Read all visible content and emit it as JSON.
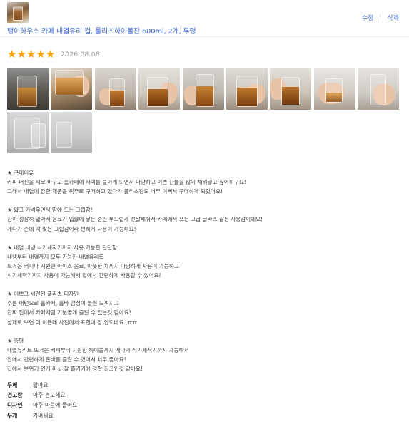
{
  "product": {
    "title": "탱이하우스 카페 내열유리 컵, 플리츠하이볼잔 600ml, 2개, 투명"
  },
  "actions": {
    "edit": "수정",
    "delete": "삭제"
  },
  "review": {
    "rating": 5,
    "rating_max": 5,
    "star_color": "#f6a200",
    "date": "2026.08.08",
    "photo_count": 10,
    "paragraphs": [
      [
        "★ 구매이유",
        "커피 머신을 새로 바꾸고 홈카페에 재미를 붙이게 되면서 다양하고 이쁜 잔들을 많이 채워넣고 싶어하구요!",
        "그래서 내열에 강한 제품을 위주로 구매하고 있다가 플리츠잔도 너무 이뻐서 구매하게 되었어요!"
      ],
      [
        "★ 얇고 가벼우면서 맘에 드는 그립감!",
        "잔이 굉장히 얇아서 음료가 입술에 닿는 순간 부드럽게 전달해줘서 카페에서 쓰는 고급 글라스 같은 사용감이에요!",
        "게다가 손에 딱 맞는 그립감이라 편하게 사용이 가능해요!"
      ],
      [
        "★ 내열 내냉 식기세척기까지 사용 가능한 탄탄함",
        "내냉부터 내열까지 모두 가능한 내열유리트",
        "뜨거운 커피나 시원한 아이스 음료, 따뜻한 차까지 다양하게 사용이 가능하고",
        "식기세척기까지 사용이 가능해서 집에서 간편하게 사용할 수 있어요!"
      ],
      [
        "★ 이쁘고 세련된 플리츠 디자인",
        "주름 패턴으로 홈카페, 홈바 감성이 물씬 느껴지고",
        "진짜 집에서 카페처럼 기분좋게 즐길 수 있는것 같아요!",
        "실제로 보면 더 이쁜데 사진에서 표현이 잘 안되네요..ㅠㅠ"
      ],
      [
        "★ 총평",
        "내열유리트 뜨거운 커피부터 시원한 하이볼까지 게다가 식기세척기까지 가능해서",
        "집에서 간편하게 홈바를 즐길 수 있어서 너무 좋아요!",
        "집에서 분위기 있게 마실 잘 즐기기에 정말 최고인것 같아요!"
      ]
    ],
    "attributes": [
      {
        "key": "두께",
        "value": "얇아요"
      },
      {
        "key": "견고함",
        "value": "아주 견고해요"
      },
      {
        "key": "디자인",
        "value": "아주 마음에 들어요"
      },
      {
        "key": "무게",
        "value": "가벼워요"
      }
    ]
  }
}
